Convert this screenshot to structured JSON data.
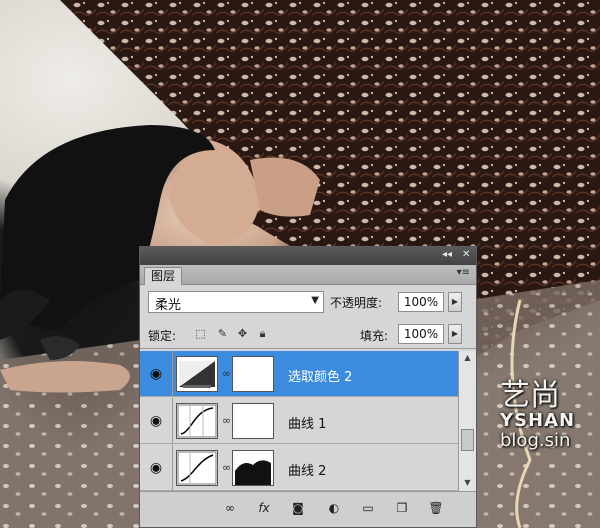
{
  "watermark": {
    "chinese": "艺尚",
    "brand": "YSHAN",
    "url": "blog.sin"
  },
  "panel": {
    "tab_label": "图层",
    "collapse_glyph": "◂◂",
    "close_glyph": "✕",
    "menu_glyph": "▾≡",
    "blend_mode": "柔光",
    "opacity_label": "不透明度:",
    "opacity_value": "100%",
    "lock_label": "锁定:",
    "fill_label": "填充:",
    "fill_value": "100%",
    "layers": [
      {
        "name": "选取颜色 2",
        "selected": true
      },
      {
        "name": "曲线 1",
        "selected": false
      },
      {
        "name": "曲线 2",
        "selected": false
      }
    ],
    "bottom_icons": [
      "link-icon",
      "fx-icon",
      "mask-icon",
      "adjustment-icon",
      "group-icon",
      "new-layer-icon",
      "trash-icon"
    ]
  }
}
